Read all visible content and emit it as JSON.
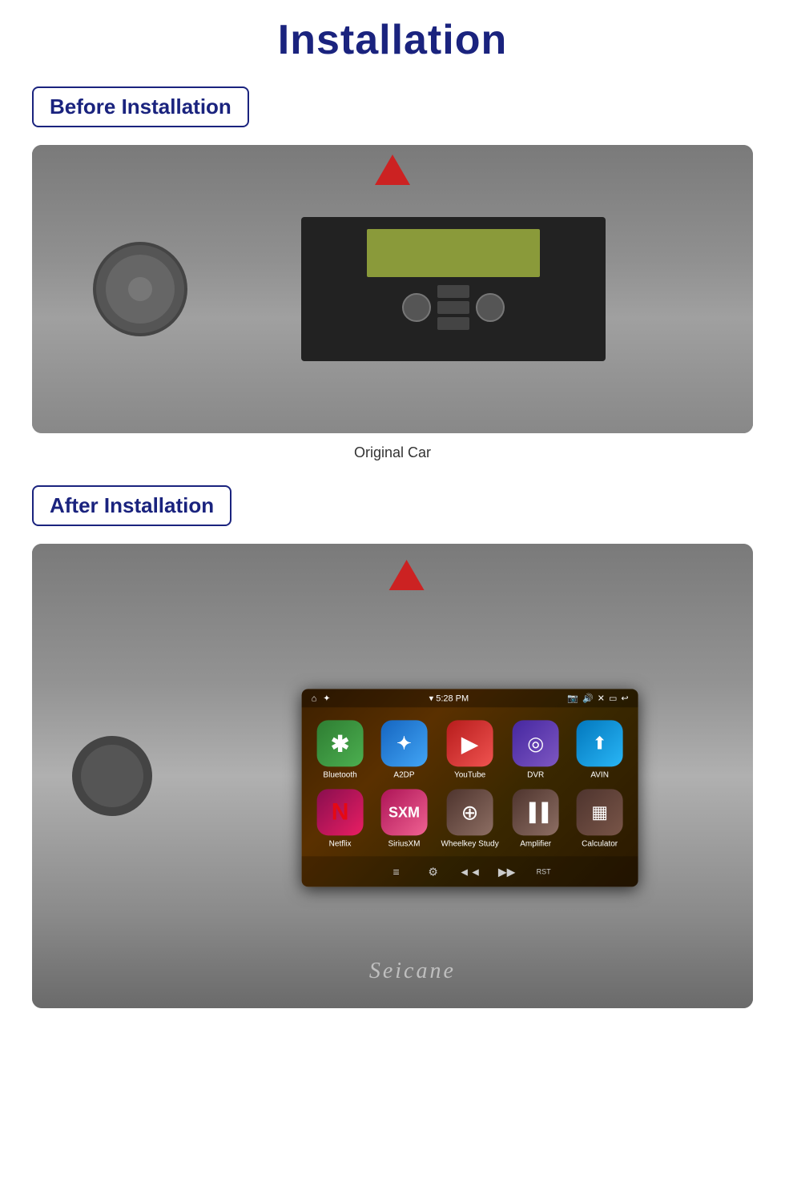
{
  "page": {
    "title": "Installation"
  },
  "before_section": {
    "badge": "Before Installation",
    "caption": "Original Car",
    "image_alt": "Car interior before installation showing old head unit"
  },
  "after_section": {
    "badge": "After Installation",
    "image_alt": "Car interior after installation showing Android head unit"
  },
  "android_screen": {
    "statusbar": {
      "home_icon": "⌂",
      "wifi_icon": "✦",
      "time": "▾ 5:28 PM",
      "icons": "📷 🔊 ✕ ▭ ↩"
    },
    "apps_row1": [
      {
        "name": "Bluetooth",
        "class": "app-bluetooth",
        "symbol": "✦"
      },
      {
        "name": "A2DP",
        "class": "app-a2dp",
        "symbol": "✦"
      },
      {
        "name": "YouTube",
        "class": "app-youtube",
        "symbol": "▶"
      },
      {
        "name": "DVR",
        "class": "app-dvr",
        "symbol": "◎"
      },
      {
        "name": "AVIN",
        "class": "app-avin",
        "symbol": "⬆"
      }
    ],
    "apps_row2": [
      {
        "name": "Netflix",
        "class": "app-netflix",
        "symbol": "N"
      },
      {
        "name": "SiriusXM",
        "class": "app-siriusxm",
        "symbol": "⟳"
      },
      {
        "name": "Wheelkey Study",
        "class": "app-wheelkey",
        "symbol": "⊕"
      },
      {
        "name": "Amplifier",
        "class": "app-amplifier",
        "symbol": "▐▐"
      },
      {
        "name": "Calculator",
        "class": "app-calculator",
        "symbol": "▦"
      }
    ],
    "bottom_icons": [
      "≡",
      "⚙",
      "◄◄",
      "▶▶",
      "RST"
    ],
    "brand": "Seicane"
  }
}
